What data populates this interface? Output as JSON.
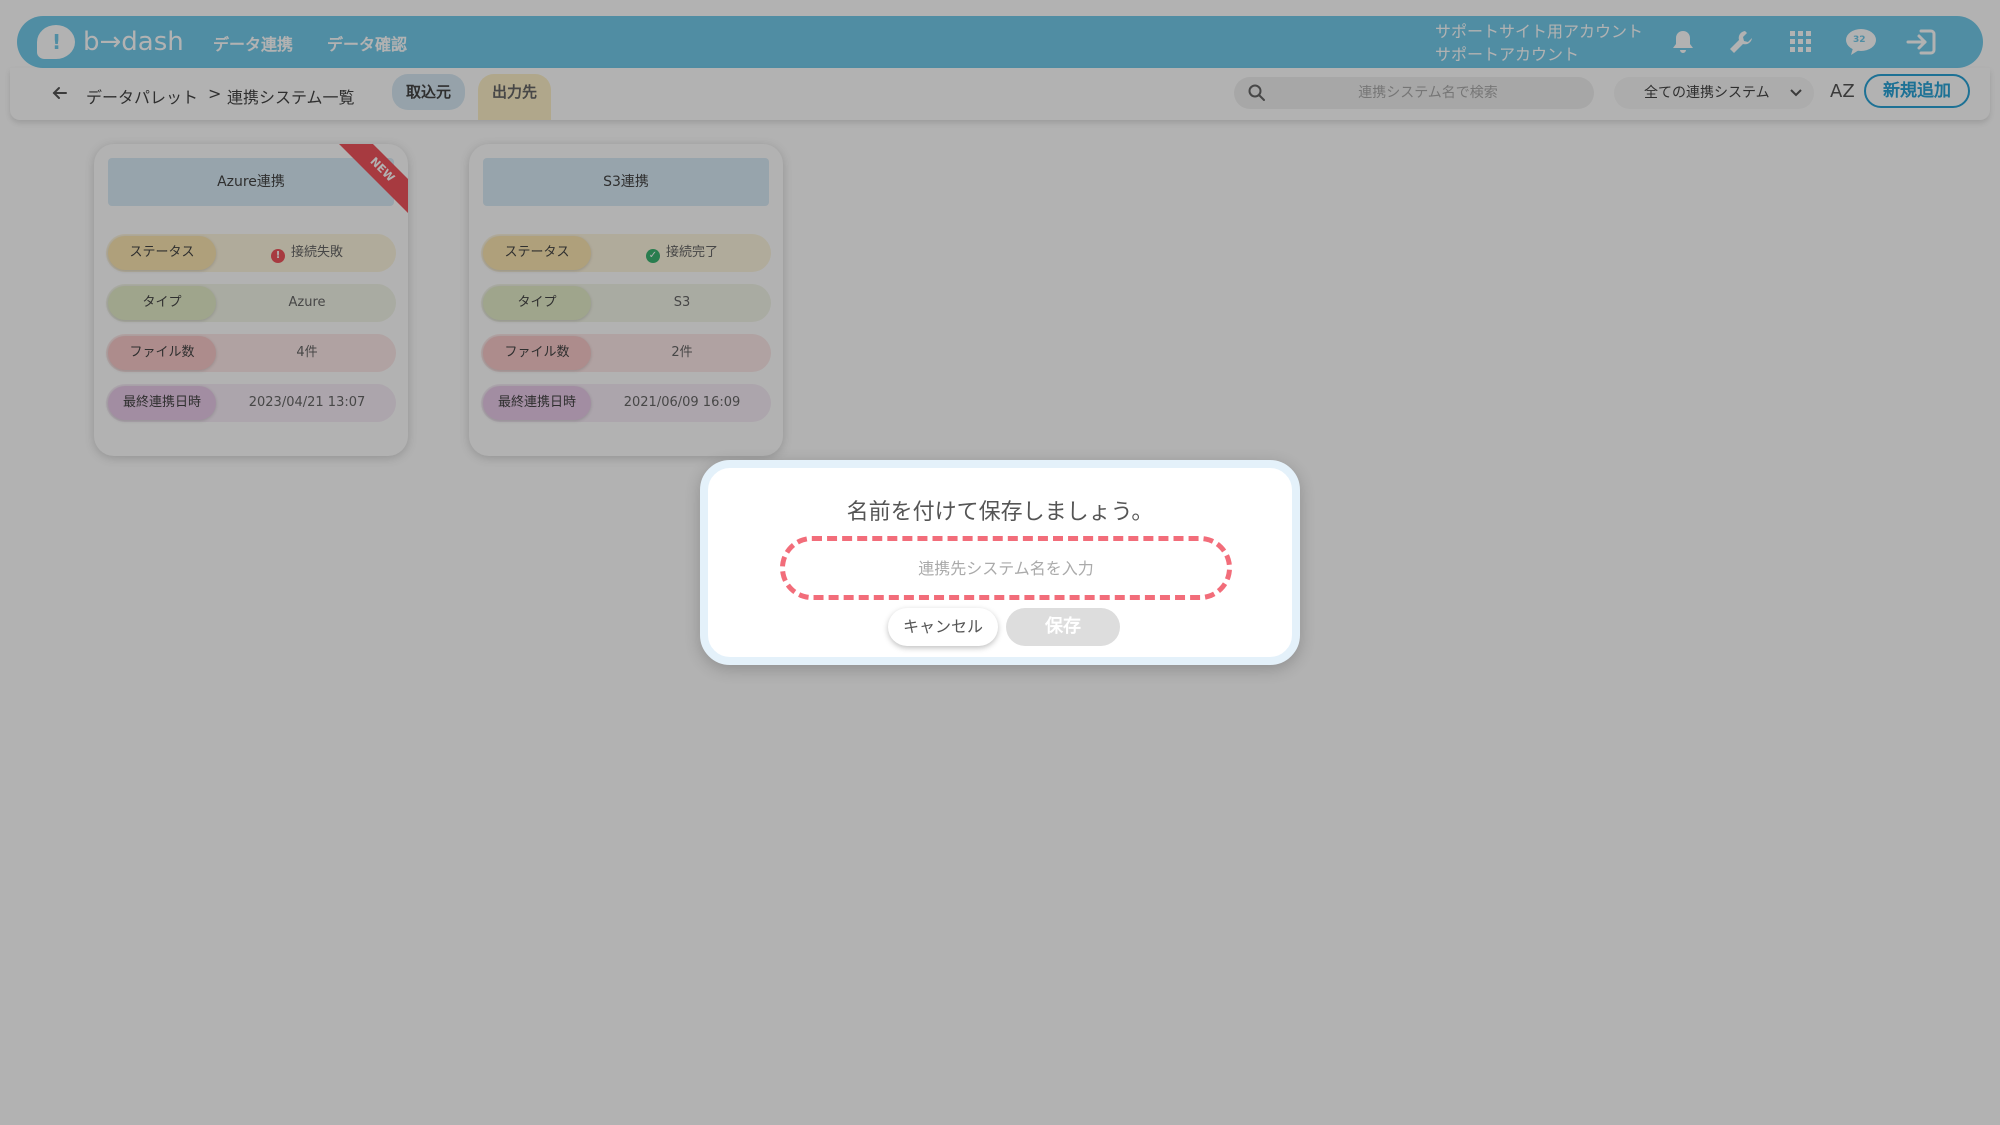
{
  "header": {
    "logo_text": "b→dash",
    "nav": [
      "データ連携",
      "データ確認"
    ],
    "account_line1": "サポートサイト用アカウント",
    "account_line2": "サポートアカウント",
    "chat_badge": "32"
  },
  "subbar": {
    "breadcrumb_root": "データパレット",
    "breadcrumb_sep": ">",
    "breadcrumb_current": "連携システム一覧",
    "tab_in": "取込元",
    "tab_out": "出力先",
    "search_placeholder": "連携システム名で検索",
    "filter_selected": "全ての連携システム",
    "sort_label": "AZ",
    "new_button": "新規追加"
  },
  "labels": {
    "status": "ステータス",
    "type": "タイプ",
    "files": "ファイル数",
    "last_sync": "最終連携日時"
  },
  "cards": [
    {
      "title": "Azure連携",
      "ribbon": "NEW",
      "status": "接続失敗",
      "status_kind": "error",
      "type": "Azure",
      "files": "4件",
      "last_sync": "2023/04/21 13:07"
    },
    {
      "title": "S3連携",
      "ribbon": "",
      "status": "接続完了",
      "status_kind": "ok",
      "type": "S3",
      "files": "2件",
      "last_sync": "2021/06/09 16:09"
    }
  ],
  "modal": {
    "title": "名前を付けて保存しましょう。",
    "input_placeholder": "連携先システム名を入力",
    "input_value": "",
    "cancel": "キャンセル",
    "save": "保存"
  },
  "colors": {
    "header": "#73cbea",
    "accent": "#2aa3d6",
    "error": "#f0545c",
    "ok": "#3cb371",
    "dashed_border": "#f26d7a"
  }
}
